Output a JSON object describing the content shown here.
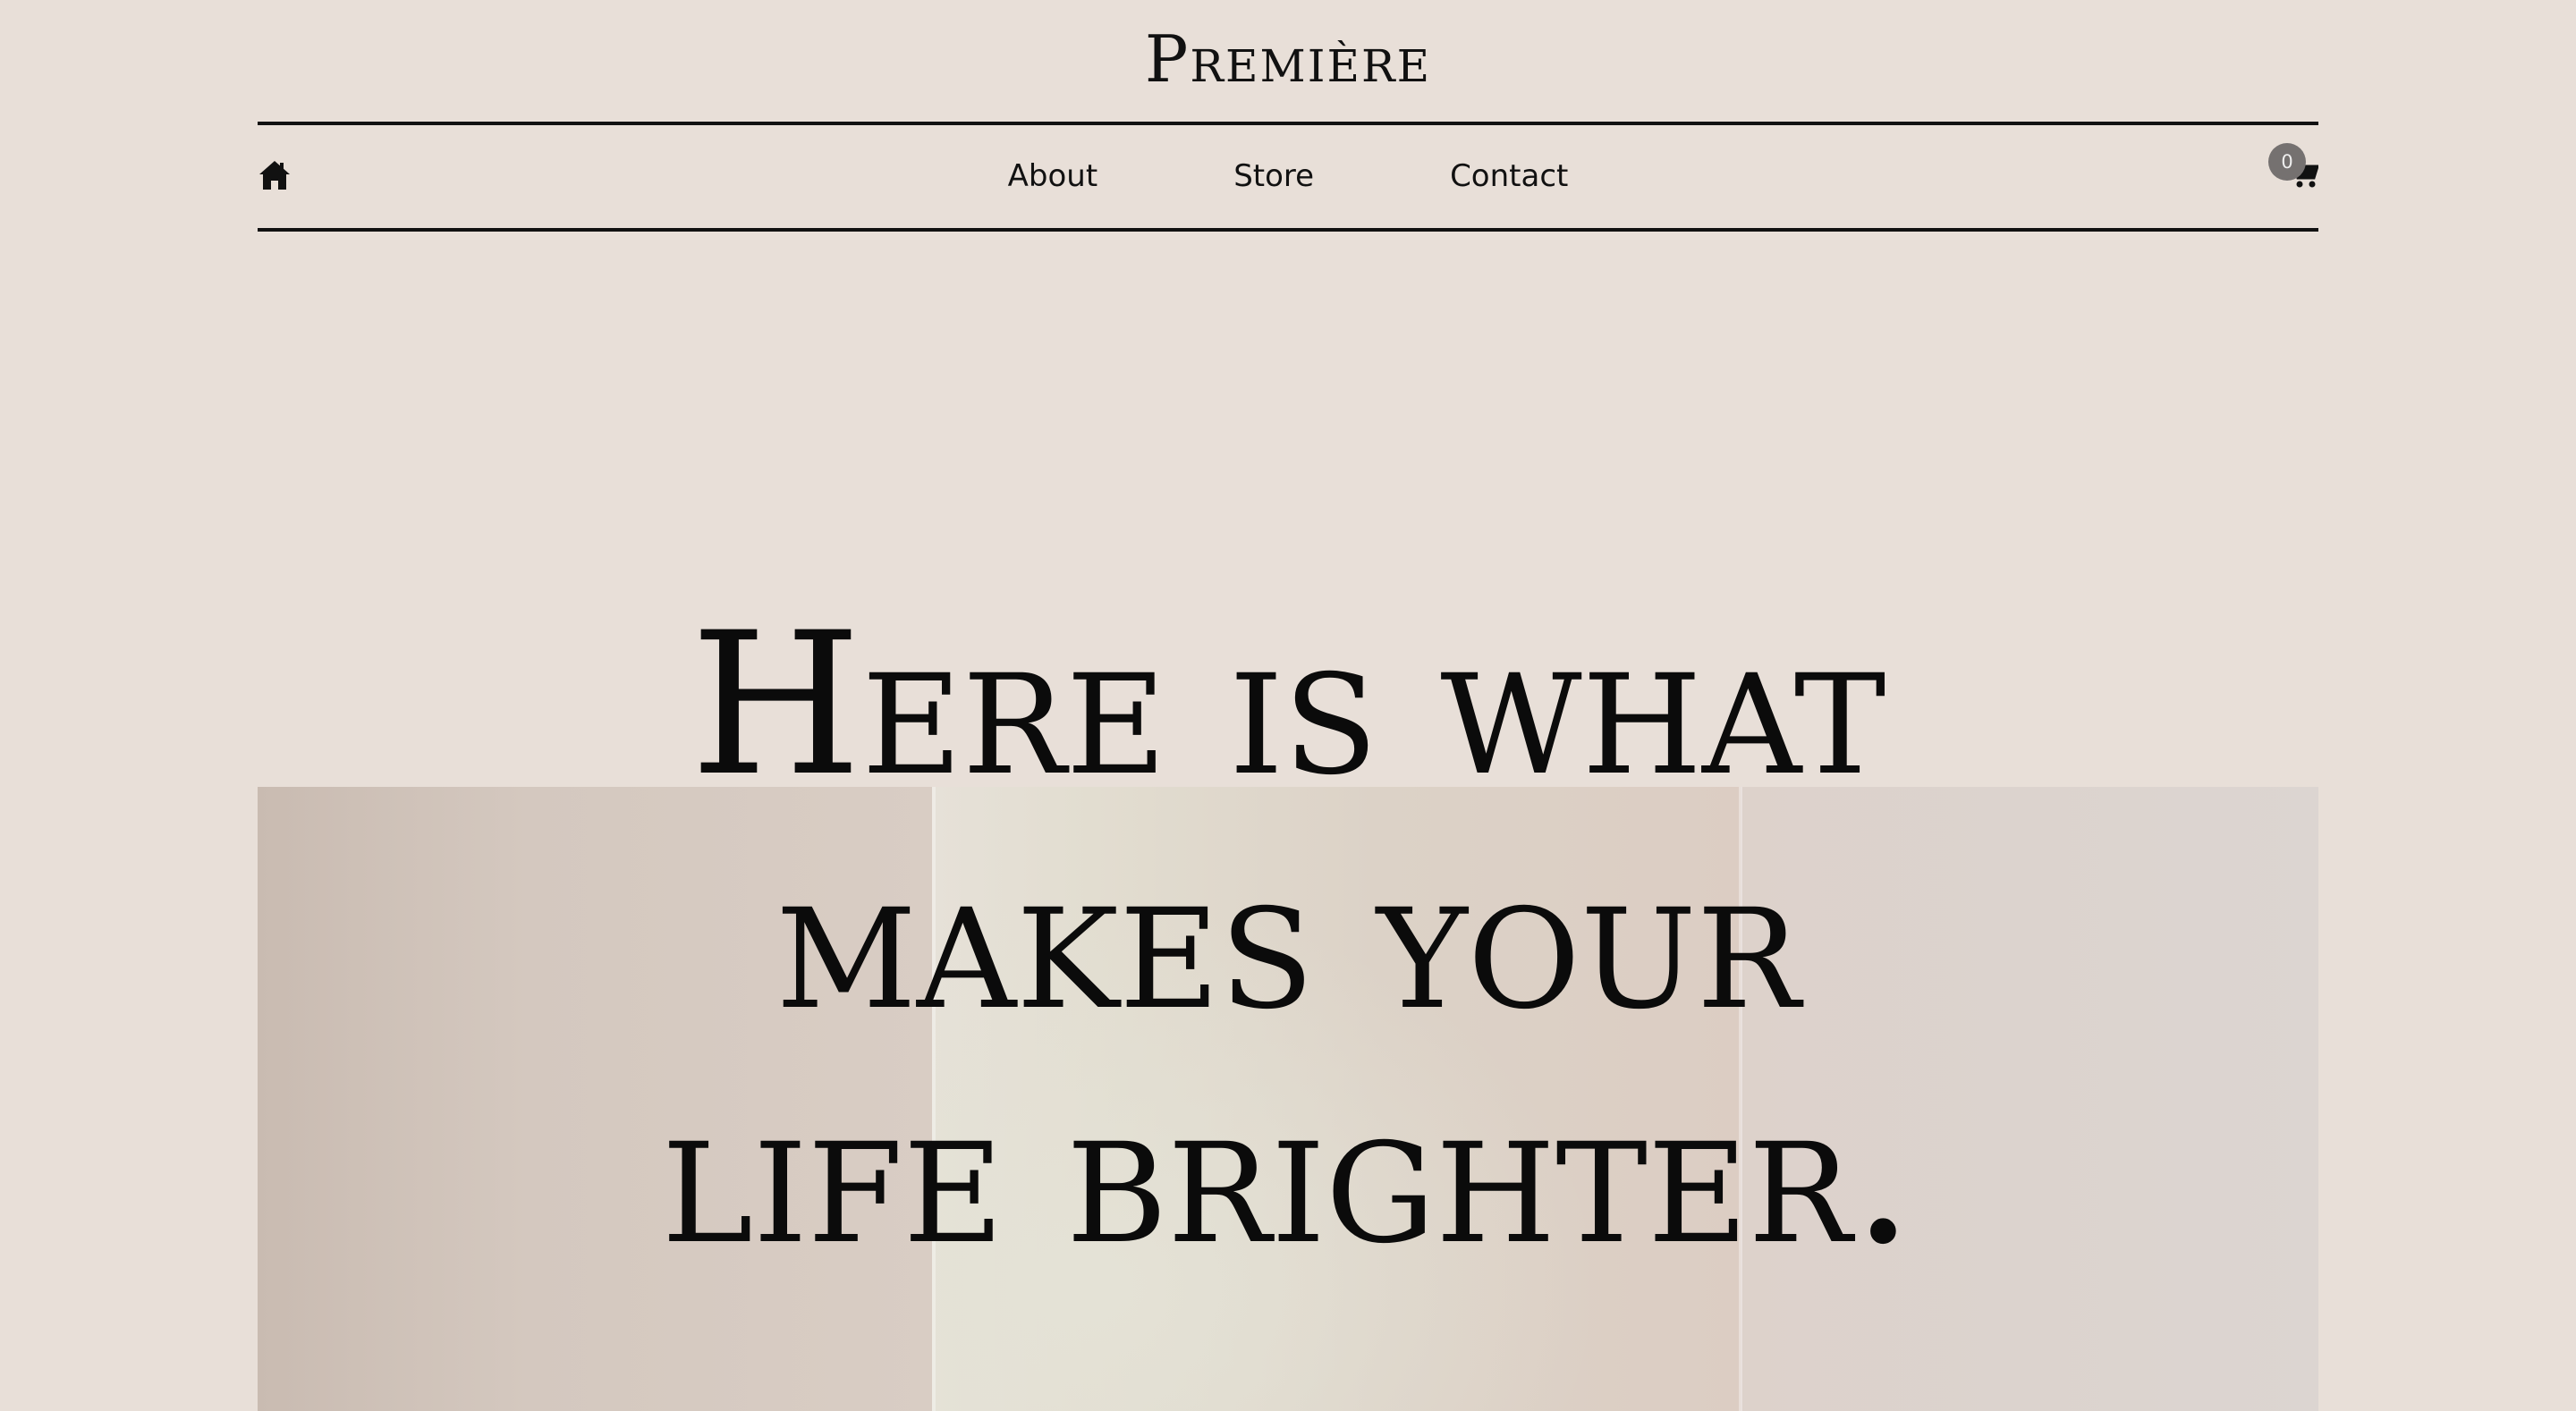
{
  "brand": {
    "name": "Première"
  },
  "nav": {
    "home_icon": "home-icon",
    "links": [
      "About",
      "Store",
      "Contact"
    ],
    "cart_icon": "cart-icon",
    "cart_count": "0"
  },
  "hero": {
    "headline_lines": [
      "Here is what",
      "makes your",
      "life brighter."
    ]
  },
  "colors": {
    "background": "#e8dfd8",
    "text": "#0a0a0a",
    "badge": "#757170"
  }
}
